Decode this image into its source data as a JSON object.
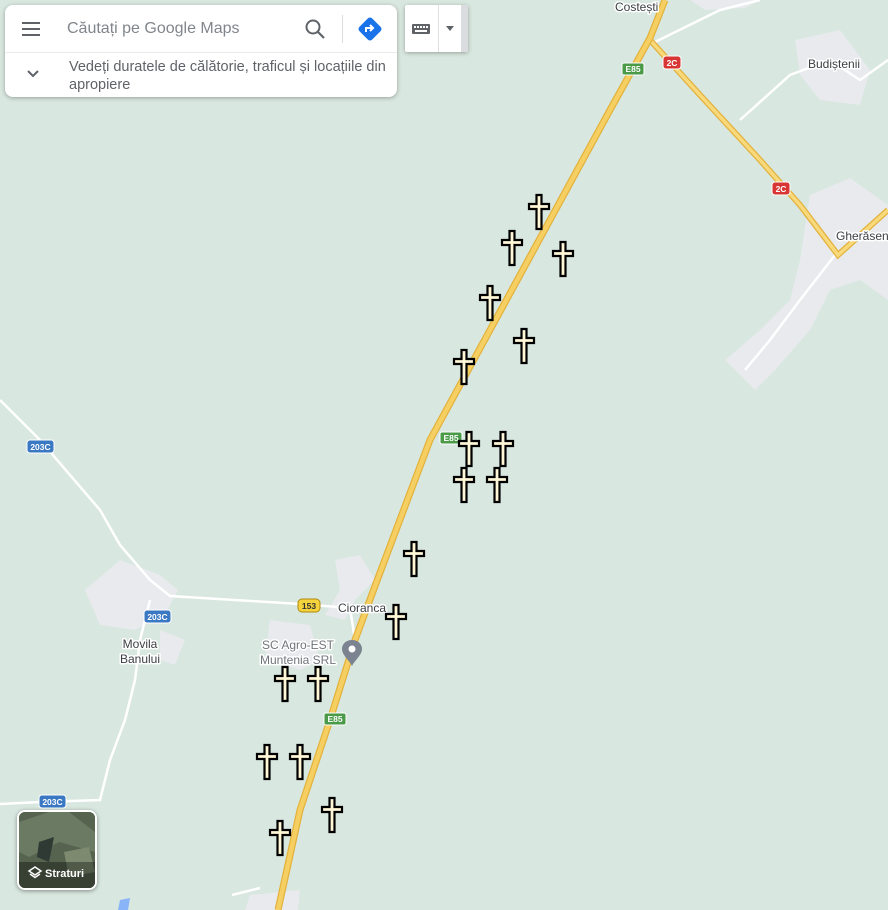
{
  "search": {
    "placeholder": "Căutați pe Google Maps"
  },
  "travel_hint": "Vedeți duratele de călătorie, traficul și locațiile din apropiere",
  "layers_label": "Straturi",
  "places": [
    {
      "name": "Costești"
    },
    {
      "name": "Budiștenii"
    },
    {
      "name": "Gherăseni"
    },
    {
      "name": "Cioranca"
    },
    {
      "name": "Movila\nBanului"
    },
    {
      "name": "SC Agro-EST\nMuntenia SRL"
    }
  ],
  "road_shields": [
    {
      "label": "E85",
      "kind": "european"
    },
    {
      "label": "E85",
      "kind": "european"
    },
    {
      "label": "E85",
      "kind": "european"
    },
    {
      "label": "2C",
      "kind": "national"
    },
    {
      "label": "2C",
      "kind": "national"
    },
    {
      "label": "203C",
      "kind": "county"
    },
    {
      "label": "203C",
      "kind": "county"
    },
    {
      "label": "203C",
      "kind": "county"
    },
    {
      "label": "153",
      "kind": "local"
    }
  ],
  "markers": {
    "icon": "cross-icon",
    "count": 20
  },
  "colors": {
    "map_bg": "#d8e7df",
    "highway": "#f6cf63",
    "highway_edge": "#e3b23c",
    "minor_road": "#ffffff",
    "settlement": "#e8eaee",
    "european_shield": "#4a9a48",
    "national_shield": "#d83535",
    "county_shield": "#3b78c4",
    "local_shield": "#f5d33c",
    "pin": "#7b8391",
    "cross_fill": "#fff7d6",
    "cross_outline": "#000000"
  }
}
